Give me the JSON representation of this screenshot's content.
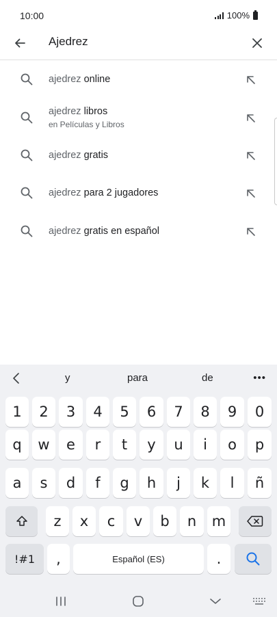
{
  "status_bar": {
    "time": "10:00",
    "battery_text": "100%"
  },
  "search": {
    "query": "Ajedrez"
  },
  "suggestions": [
    {
      "prefix": "ajedrez",
      "completion": "online",
      "subtitle": ""
    },
    {
      "prefix": "ajedrez",
      "completion": "libros",
      "subtitle": "en Películas y Libros"
    },
    {
      "prefix": "ajedrez",
      "completion": "gratis",
      "subtitle": ""
    },
    {
      "prefix": "ajedrez",
      "completion": "para 2 jugadores",
      "subtitle": ""
    },
    {
      "prefix": "ajedrez",
      "completion": "gratis en español",
      "subtitle": ""
    }
  ],
  "keyboard": {
    "predictions": [
      "y",
      "para",
      "de"
    ],
    "more_label": "•••",
    "number_row": [
      "1",
      "2",
      "3",
      "4",
      "5",
      "6",
      "7",
      "8",
      "9",
      "0"
    ],
    "row1": [
      "q",
      "w",
      "e",
      "r",
      "t",
      "y",
      "u",
      "i",
      "o",
      "p"
    ],
    "row2": [
      "a",
      "s",
      "d",
      "f",
      "g",
      "h",
      "j",
      "k",
      "l",
      "ñ"
    ],
    "row3": [
      "z",
      "x",
      "c",
      "v",
      "b",
      "n",
      "m"
    ],
    "symbols_label": "!#1",
    "comma_label": ",",
    "space_label": "Español (ES)",
    "period_label": "."
  },
  "colors": {
    "accent": "#1a73e8",
    "keyboard_bg": "#f0f1f4",
    "key_bg": "#ffffff",
    "dark_key_bg": "#e0e2e6"
  },
  "icons": {
    "back": "arrow-back-icon",
    "clear": "close-icon",
    "suggestion": "search-icon",
    "fill_query": "arrow-up-left-icon",
    "shift": "shift-icon",
    "backspace": "backspace-icon",
    "search_key": "search-icon"
  }
}
